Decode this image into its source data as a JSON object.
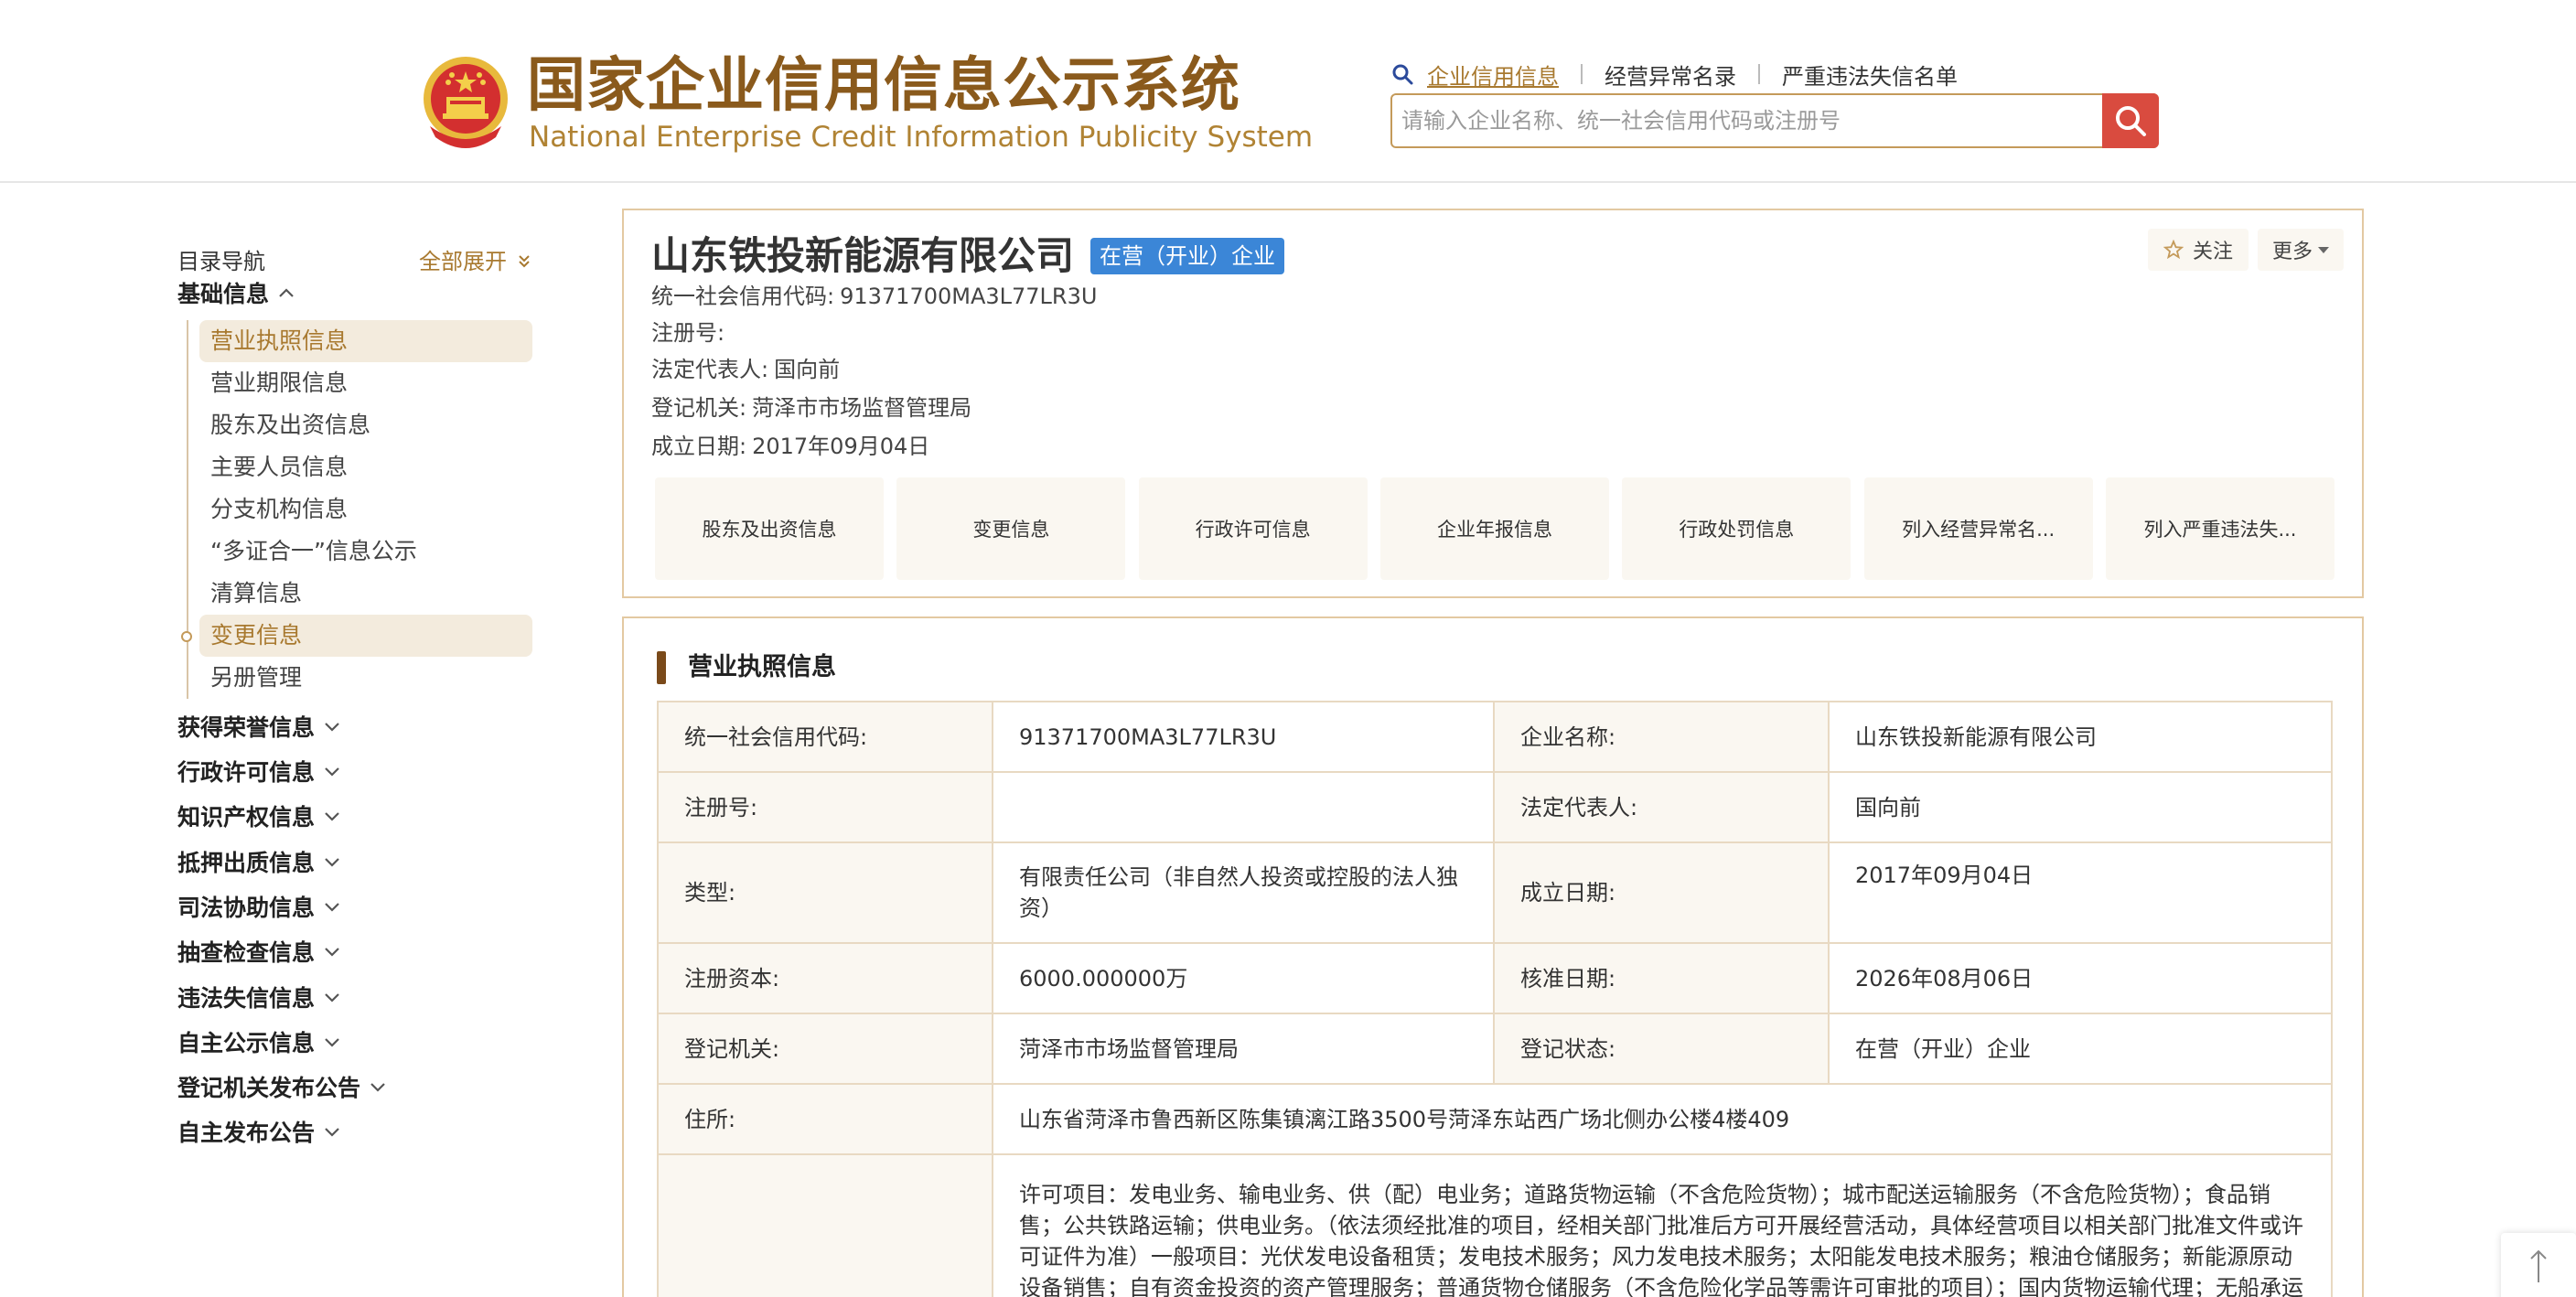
{
  "header": {
    "logo_cn": "国家企业信用信息公示系统",
    "logo_en": "National Enterprise Credit Information Publicity System",
    "search_tabs": [
      "企业信用信息",
      "经营异常名录",
      "严重违法失信名单"
    ],
    "search_placeholder": "请输入企业名称、统一社会信用代码或注册号",
    "colors": {
      "brand": "#8a5a1c",
      "accent": "#a8792f",
      "search_button": "#d94b3f"
    }
  },
  "sidebar": {
    "title": "目录导航",
    "expand_all": "全部展开",
    "basic_section": "基础信息",
    "basic_items": [
      "营业执照信息",
      "营业期限信息",
      "股东及出资信息",
      "主要人员信息",
      "分支机构信息",
      "“多证合一”信息公示",
      "清算信息",
      "变更信息",
      "另册管理"
    ],
    "sections": [
      "获得荣誉信息",
      "行政许可信息",
      "知识产权信息",
      "抵押出质信息",
      "司法协助信息",
      "抽查检查信息",
      "违法失信信息",
      "自主公示信息",
      "登记机关发布公告",
      "自主发布公告"
    ]
  },
  "company": {
    "name": "山东铁投新能源有限公司",
    "status": "在营（开业）企业",
    "credit_code_label": "统一社会信用代码:",
    "credit_code": "91371700MA3L77LR3U",
    "reg_no_label": "注册号:",
    "reg_no": "",
    "legal_rep_label": "法定代表人:",
    "legal_rep": "国向前",
    "authority_label": "登记机关:",
    "authority": "菏泽市市场监督管理局",
    "established_label": "成立日期:",
    "established": "2017年09月04日",
    "follow": "关注",
    "more": "更多",
    "quick_links": [
      "股东及出资信息",
      "变更信息",
      "行政许可信息",
      "企业年报信息",
      "行政处罚信息",
      "列入经营异常名...",
      "列入严重违法失..."
    ]
  },
  "license": {
    "title": "营业执照信息",
    "rows": [
      {
        "l1": "统一社会信用代码:",
        "v1": "91371700MA3L77LR3U",
        "l2": "企业名称:",
        "v2": "山东铁投新能源有限公司"
      },
      {
        "l1": "注册号:",
        "v1": "",
        "l2": "法定代表人:",
        "v2": "国向前"
      },
      {
        "l1": "类型:",
        "v1": "有限责任公司（非自然人投资或控股的法人独资）",
        "l2": "成立日期:",
        "v2": "2017年09月04日"
      },
      {
        "l1": "注册资本:",
        "v1": "6000.000000万",
        "l2": "核准日期:",
        "v2": "2026年08月06日"
      },
      {
        "l1": "登记机关:",
        "v1": "菏泽市市场监督管理局",
        "l2": "登记状态:",
        "v2": "在营（开业）企业"
      }
    ],
    "address_label": "住所:",
    "address": "山东省菏泽市鲁西新区陈集镇漓江路3500号菏泽东站西广场北侧办公楼4楼409",
    "scope_label": "",
    "scope": "许可项目：发电业务、输电业务、供（配）电业务；道路货物运输（不含危险货物）；城市配送运输服务（不含危险货物）；食品销售；公共铁路运输；供电业务。（依法须经批准的项目，经相关部门批准后方可开展经营活动，具体经营项目以相关部门批准文件或许可证件为准）一般项目：光伏发电设备租赁；发电技术服务；风力发电技术服务；太阳能发电技术服务；粮油仓储服务；新能源原动设备销售；自有资金投资的资产管理服务；普通货物仓储服务（不含危险化学品等需许可审批的项目）；国内货物运输代理；无船承运业"
  }
}
